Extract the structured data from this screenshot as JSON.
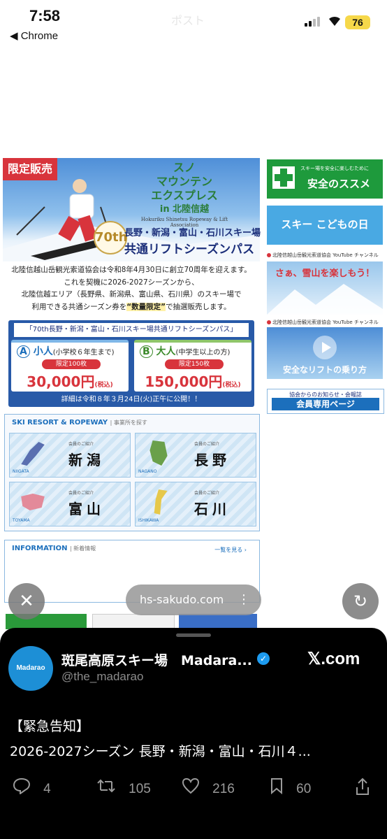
{
  "status_bar": {
    "time": "7:58",
    "back_app": "◀ Chrome",
    "battery": "76",
    "ghost_title": "ポスト"
  },
  "webpage": {
    "banner": {
      "limited_tag": "限定販売",
      "logo_lines": [
        "スノ",
        "マウンテン",
        "エクスプレス",
        "in 北陸信越"
      ],
      "logo_sub": "Hokuriku Shinetsu Ropeway & Lift Association",
      "anniv_badge": "70th",
      "line1": "長野・新潟・富山・石川スキー場",
      "line2": "共通リフトシーズンパス"
    },
    "intro": [
      "北陸信越山岳観光索道協会は令和8年4月30日に創立70周年を迎えます。",
      "これを契機に2026-2027シーズンから、",
      "北陸信越エリア（長野県、新潟県、富山県、石川県）のスキー場で",
      "利用できる共通シーズン券を",
      "“数量限定”",
      "で抽選販売します。"
    ],
    "pass_panel": {
      "title": "「70th長野・新潟・富山・石川スキー場共通リフトシーズンパス」",
      "card_a": {
        "mark": "A",
        "label": "小人",
        "note": "(小学校６年生まで)",
        "limit": "限定100枚",
        "price": "30,000円",
        "tax": "(税込)"
      },
      "card_b": {
        "mark": "B",
        "label": "大人",
        "note": "(中学生以上の方)",
        "limit": "限定150枚",
        "price": "150,000円",
        "tax": "(税込)"
      },
      "footer": "詳細は令和８年３月24日(火)正午に公開！！"
    },
    "sidebar": {
      "safety_small": "スキー場を安全に楽しむために",
      "safety_big": "安全のススメ",
      "kids_text": "スキー こどもの日",
      "yt_label_1": "北陸信越山岳観光索道協会 YouTube チャンネル",
      "snow_text": "さぁ、雪山を楽しもう！",
      "yt_label_2": "北陸信越山岳観光索道協会 YouTube チャンネル",
      "lift_text": "安全なリフトの乗り方",
      "member_small": "協会からのお知らせ・会報誌",
      "member_btn": "会員専用ページ"
    },
    "resorts": {
      "title": "SKI RESORT & ROPEWAY",
      "subtitle": "| 事業所を探す",
      "intro_label": "会員のご紹介",
      "regions": [
        {
          "name": "新潟",
          "roman": "NIIGATA",
          "map_color": "#5a6fb0"
        },
        {
          "name": "長野",
          "roman": "NAGANO",
          "map_color": "#6aa04a"
        },
        {
          "name": "富山",
          "roman": "TOYAMA",
          "map_color": "#e38a9a"
        },
        {
          "name": "石川",
          "roman": "ISHIKAWA",
          "map_color": "#e6c84a"
        }
      ]
    },
    "information": {
      "title": "INFORMATION",
      "subtitle": "| 新着情報",
      "more": "一覧を見る ›"
    }
  },
  "browser_overlay": {
    "close_icon": "✕",
    "url": "hs-sakudo.com",
    "menu_dots": "⋮",
    "reload_icon": "↻"
  },
  "tweet": {
    "avatar_text": "Madarao",
    "display_name": "斑尾高原スキー場　Madara...",
    "handle": "@the_madarao",
    "site": "𝕏.com",
    "text_line1": "【緊急告知】",
    "text_line2": "2026-2027シーズン 長野・新潟・富山・石川４...",
    "counts": {
      "replies": "4",
      "reposts": "105",
      "likes": "216",
      "bookmarks": "60"
    }
  }
}
